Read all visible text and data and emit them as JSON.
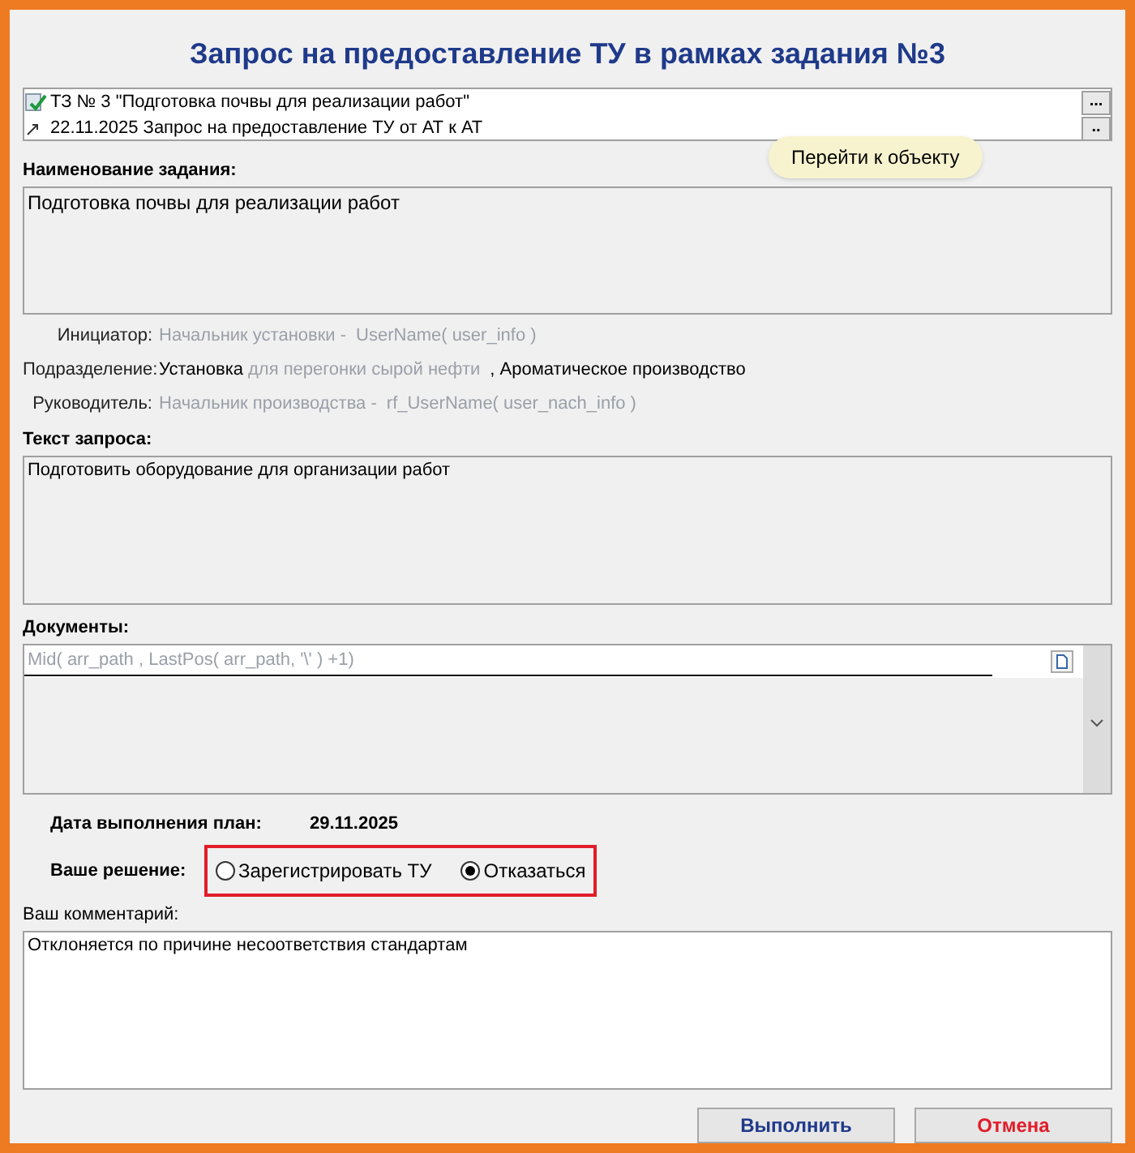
{
  "window": {
    "title": "Запрос на предоставление ТУ в рамках задания №3"
  },
  "linked_objects": [
    {
      "kind": "task",
      "text": "ТЗ № 3 \"Подготовка почвы для реализации работ\"",
      "button": "..."
    },
    {
      "kind": "request",
      "text": "22.11.2025 Запрос на предоставление ТУ от АТ к АТ",
      "button": ".."
    }
  ],
  "tooltip": "Перейти к объекту",
  "task_name": {
    "label": "Наименование задания:",
    "value": "Подготовка почвы для реализации работ"
  },
  "info": [
    {
      "label": "Инициатор:",
      "parts": [
        {
          "text": "Начальник установки -",
          "blurred": true
        },
        {
          "text": "UserName( user_info )",
          "blurred": true
        }
      ]
    },
    {
      "label": "Подразделение:",
      "parts": [
        {
          "text": "Установка",
          "blurred": false
        },
        {
          "text": "для перегонки сырой нефти",
          "blurred": true
        },
        {
          "text": ", Ароматическое производство",
          "blurred": false
        }
      ]
    },
    {
      "label": "Руководитель:",
      "parts": [
        {
          "text": "Начальник производства -",
          "blurred": true
        },
        {
          "text": "rf_UserName( user_nach_info )",
          "blurred": true
        }
      ]
    }
  ],
  "request_text": {
    "label": "Текст запроса:",
    "value": "Подготовить оборудование для организации работ"
  },
  "documents": {
    "label": "Документы:",
    "rows": [
      "Mid( arr_path , LastPos( arr_path, '\\' ) +1)"
    ]
  },
  "due_date": {
    "label": "Дата выполнения план:",
    "value": "29.11.2025"
  },
  "decision": {
    "label": "Ваше решение:",
    "options": [
      {
        "label": "Зарегистрировать ТУ",
        "selected": false
      },
      {
        "label": "Отказаться",
        "selected": true
      }
    ]
  },
  "comment": {
    "label": "Ваш комментарий:",
    "value": "Отклоняется по причине несоответствия стандартам"
  },
  "buttons": [
    {
      "kind": "primary",
      "label": "Выполнить"
    },
    {
      "kind": "cancel",
      "label": "Отмена"
    }
  ]
}
